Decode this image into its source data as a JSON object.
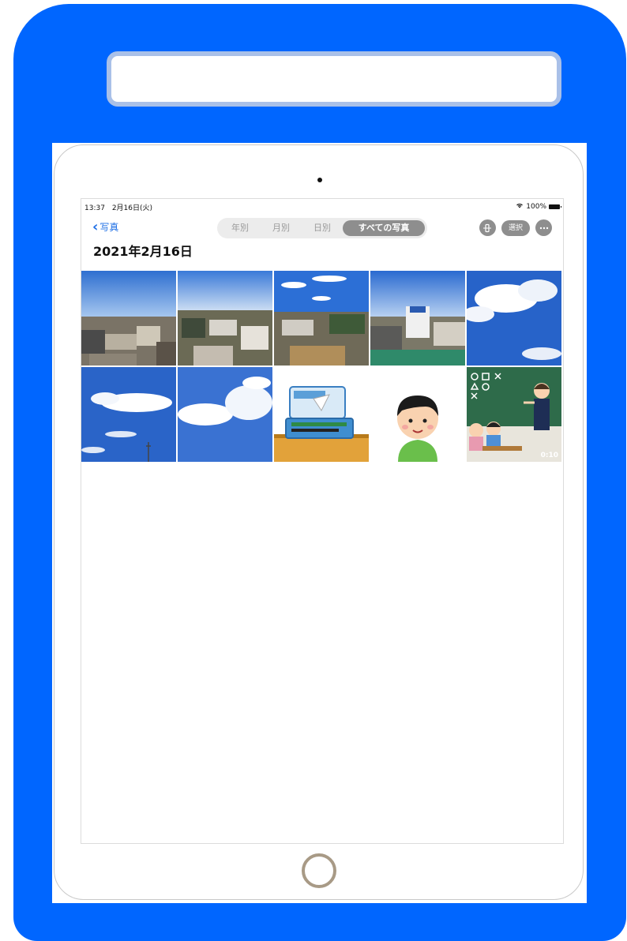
{
  "status_bar": {
    "time": "13:37",
    "date": "2月16日(火)",
    "wifi_icon": "wifi-icon",
    "battery": "100%"
  },
  "nav": {
    "back_label": "写真",
    "back_icon": "chevron-left-icon",
    "tabs": [
      {
        "label": "年別",
        "active": false
      },
      {
        "label": "月別",
        "active": false
      },
      {
        "label": "日別",
        "active": false
      },
      {
        "label": "すべての写真",
        "active": true
      }
    ],
    "select_label": "選択",
    "slideshow_icon": "phone-rotate-icon",
    "more_icon": "ellipsis-icon"
  },
  "page_title": "2021年2月16日",
  "photos": [
    {
      "kind": "town-photo"
    },
    {
      "kind": "town-photo"
    },
    {
      "kind": "town-photo"
    },
    {
      "kind": "town-photo"
    },
    {
      "kind": "sky-photo"
    },
    {
      "kind": "sky-photo"
    },
    {
      "kind": "sky-photo"
    },
    {
      "kind": "pencil-case-illustration"
    },
    {
      "kind": "boy-illustration"
    },
    {
      "kind": "classroom-video",
      "duration": "0:10"
    }
  ],
  "colors": {
    "frame": "#0066ff",
    "accent": "#1f6fe5",
    "segment_active": "#8e8e8e",
    "home_ring": "#a89a86"
  }
}
